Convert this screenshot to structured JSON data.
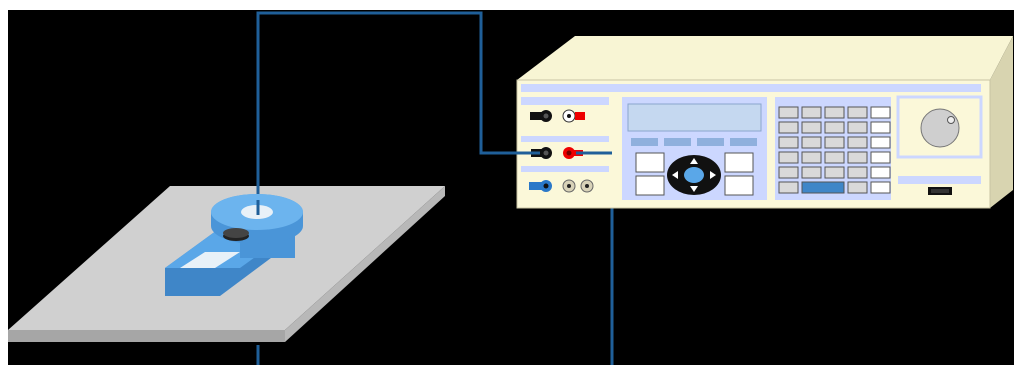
{
  "scene": {
    "background": "#000000",
    "frame_color": "#ffffff",
    "wire_color": "#1f5f99",
    "panel_color": "#d0d0d0",
    "calibrator": {
      "body_color": "#fbf8d9",
      "accent_color": "#ccd7ff",
      "input_jacks": [
        "black",
        "red"
      ],
      "output_jacks": [
        "black",
        "red"
      ],
      "aux_jacks": [
        "blue",
        "tan",
        "tan"
      ],
      "display_color": "#c5d8f0",
      "softkey_count": 4,
      "keypad_rows": 6,
      "keypad_cols": 5,
      "knob_icon": "rotary-knob-icon",
      "port_icon": "connector-port-icon"
    },
    "clamp_meter": {
      "color": "#5aa7e8",
      "jaw_icon": "current-clamp-jaw-icon",
      "display_color": "#e8f1f8"
    }
  }
}
